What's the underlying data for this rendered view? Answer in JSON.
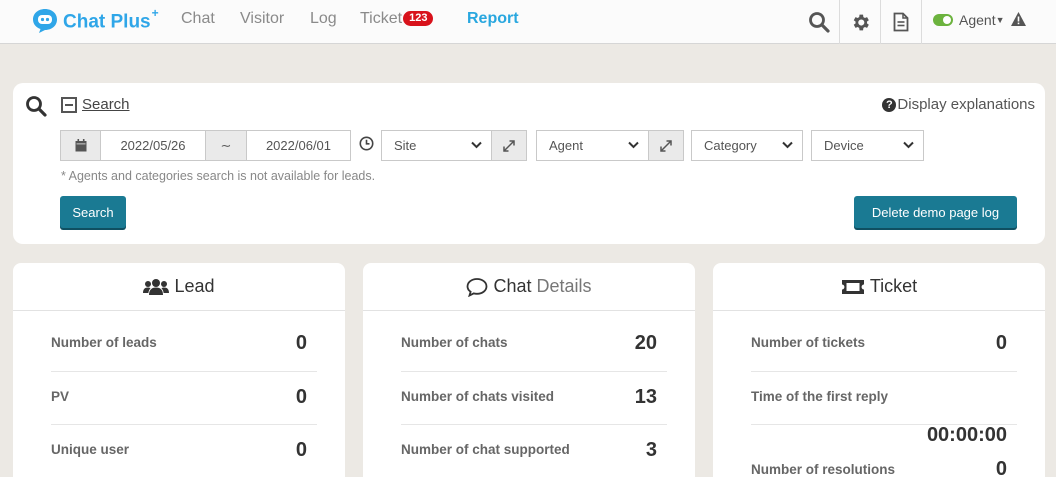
{
  "app": {
    "logo_text": "Chat Plus",
    "logo_sup": "+"
  },
  "nav": {
    "items": [
      {
        "label": "Chat"
      },
      {
        "label": "Visitor"
      },
      {
        "label": "Log"
      },
      {
        "label": "Ticket",
        "badge": "123"
      },
      {
        "label": "Report",
        "active": true
      }
    ]
  },
  "header": {
    "agent_label": "Agent",
    "agent_status": "online",
    "icons": [
      "search-icon",
      "gear-icon",
      "document-icon",
      "warning-icon"
    ]
  },
  "search": {
    "title": "Search",
    "display_explanations": "Display explanations",
    "date_from": "2022/05/26",
    "date_separator": "∼",
    "date_to": "2022/06/01",
    "site_select": "Site",
    "agent_select": "Agent",
    "category_select": "Category",
    "device_select": "Device",
    "note": "* Agents and categories search is not available for leads.",
    "search_button": "Search",
    "delete_button": "Delete demo page log"
  },
  "cards": {
    "lead": {
      "title": "Lead",
      "rows": [
        {
          "label": "Number of leads",
          "value": "0"
        },
        {
          "label": "PV",
          "value": "0"
        },
        {
          "label": "Unique user",
          "value": "0"
        }
      ]
    },
    "chat": {
      "title": "Chat",
      "title_sub": "Details",
      "rows": [
        {
          "label": "Number of chats",
          "value": "20"
        },
        {
          "label": "Number of chats visited",
          "value": "13"
        },
        {
          "label": "Number of chat supported",
          "value": "3"
        }
      ]
    },
    "ticket": {
      "title": "Ticket",
      "rows": [
        {
          "label": "Number of tickets",
          "value": "0"
        },
        {
          "label": "Time of the first reply",
          "value": "00:00:00"
        },
        {
          "label": "Number of resolutions",
          "value": "0"
        }
      ]
    }
  },
  "colors": {
    "brand": "#2fa6e8",
    "active_nav": "#29a7df",
    "badge": "#d8121b",
    "button": "#1a7a93",
    "toggle_on": "#6cb33e"
  }
}
